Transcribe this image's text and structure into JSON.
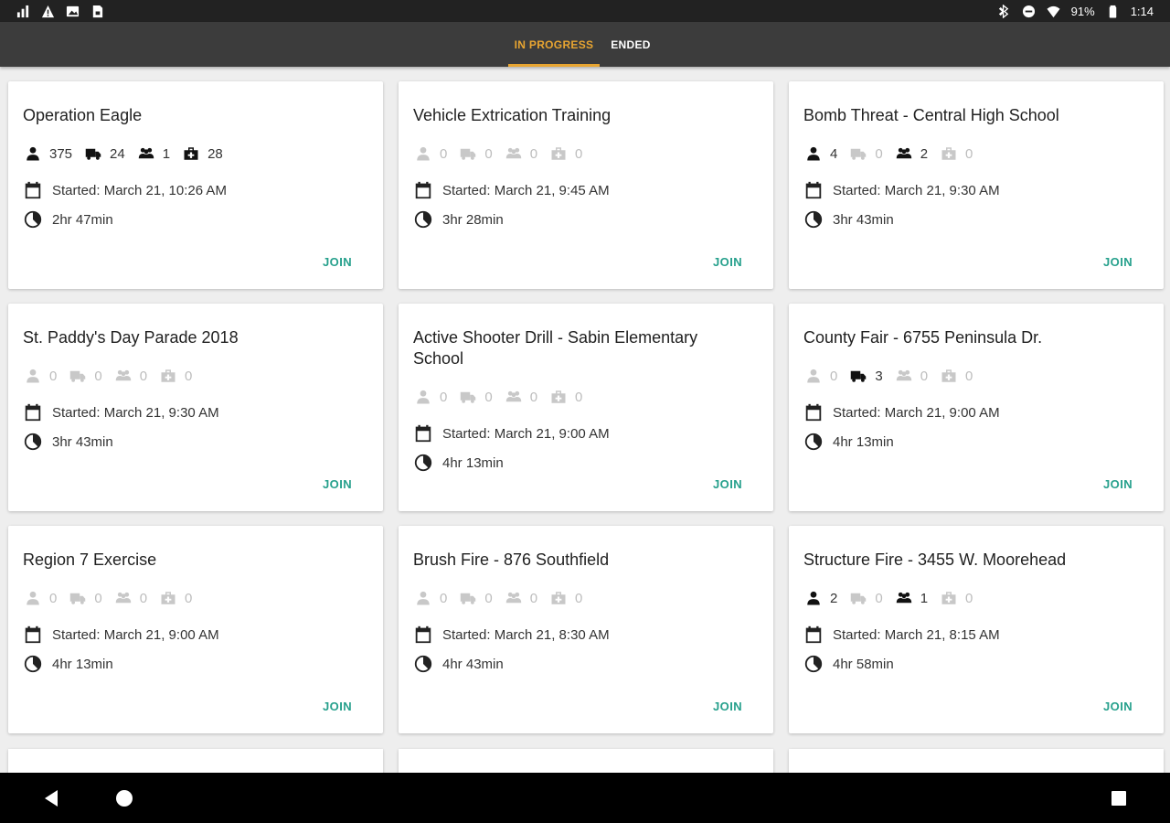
{
  "status_bar": {
    "left_icons": [
      "signal-icon",
      "warning-icon",
      "image-icon",
      "sim-card-icon"
    ],
    "battery": "91%",
    "time": "1:14"
  },
  "tabs": [
    {
      "label": "IN PROGRESS",
      "active": true
    },
    {
      "label": "ENDED",
      "active": false
    }
  ],
  "colors": {
    "accent": "#e8a531",
    "join": "#26a08c",
    "app_bar": "#3c3c3c",
    "inactive_icon": "#c8c8c8"
  },
  "stat_icons": [
    "person-icon",
    "truck-icon",
    "group-icon",
    "medkit-icon"
  ],
  "cards": [
    {
      "title": "Operation Eagle",
      "stats": [
        375,
        24,
        1,
        28
      ],
      "started": "Started: March 21, 10:26 AM",
      "duration": "2hr 47min",
      "join": "JOIN"
    },
    {
      "title": "Vehicle Extrication Training",
      "stats": [
        0,
        0,
        0,
        0
      ],
      "started": "Started: March 21, 9:45 AM",
      "duration": "3hr 28min",
      "join": "JOIN"
    },
    {
      "title": "Bomb Threat - Central High School",
      "stats": [
        4,
        0,
        2,
        0
      ],
      "started": "Started: March 21, 9:30 AM",
      "duration": "3hr 43min",
      "join": "JOIN"
    },
    {
      "title": "St. Paddy's Day Parade 2018",
      "stats": [
        0,
        0,
        0,
        0
      ],
      "started": "Started: March 21, 9:30 AM",
      "duration": "3hr 43min",
      "join": "JOIN"
    },
    {
      "title": "Active Shooter Drill - Sabin Elementary School",
      "stats": [
        0,
        0,
        0,
        0
      ],
      "started": "Started: March 21, 9:00 AM",
      "duration": "4hr 13min",
      "join": "JOIN"
    },
    {
      "title": "County Fair - 6755 Peninsula Dr.",
      "stats": [
        0,
        3,
        0,
        0
      ],
      "started": "Started: March 21, 9:00 AM",
      "duration": "4hr 13min",
      "join": "JOIN"
    },
    {
      "title": "Region 7 Exercise",
      "stats": [
        0,
        0,
        0,
        0
      ],
      "started": "Started: March 21, 9:00 AM",
      "duration": "4hr 13min",
      "join": "JOIN"
    },
    {
      "title": "Brush Fire - 876 Southfield",
      "stats": [
        0,
        0,
        0,
        0
      ],
      "started": "Started: March 21, 8:30 AM",
      "duration": "4hr 43min",
      "join": "JOIN"
    },
    {
      "title": "Structure Fire - 3455 W. Moorehead",
      "stats": [
        2,
        0,
        1,
        0
      ],
      "started": "Started: March 21, 8:15 AM",
      "duration": "4hr 58min",
      "join": "JOIN"
    }
  ],
  "nav_bar": [
    "back-icon",
    "home-icon",
    "recents-icon"
  ]
}
